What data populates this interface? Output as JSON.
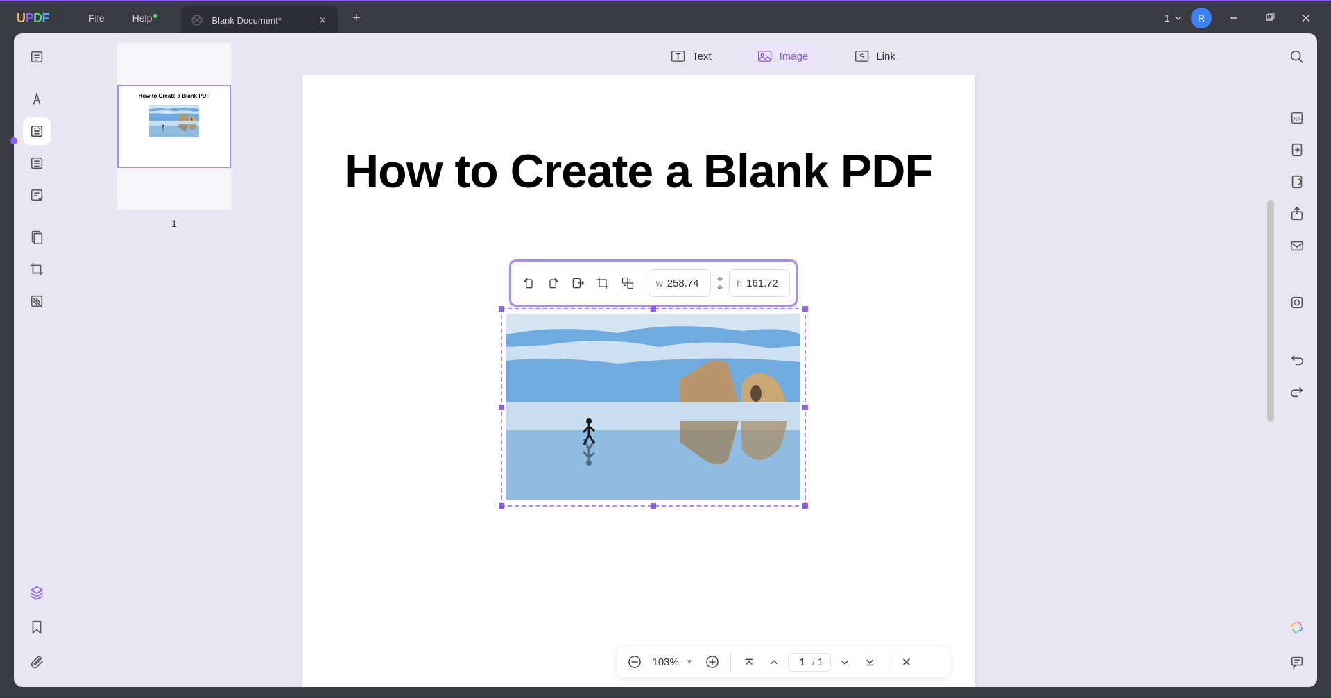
{
  "titlebar": {
    "menu_file": "File",
    "menu_help": "Help",
    "tab_title": "Blank Document*",
    "workspace_num": "1",
    "avatar_letter": "R"
  },
  "topbar": {
    "text_label": "Text",
    "image_label": "Image",
    "link_label": "Link"
  },
  "document": {
    "title": "How to Create a Blank PDF",
    "thumb_title": "How to Create a Blank PDF",
    "thumb_page_num": "1"
  },
  "image_toolbar": {
    "w_label": "w",
    "w_value": "258.74",
    "h_label": "h",
    "h_value": "161.72"
  },
  "bottombar": {
    "zoom": "103%",
    "page_current": "1",
    "page_sep": "/",
    "page_total": "1"
  }
}
